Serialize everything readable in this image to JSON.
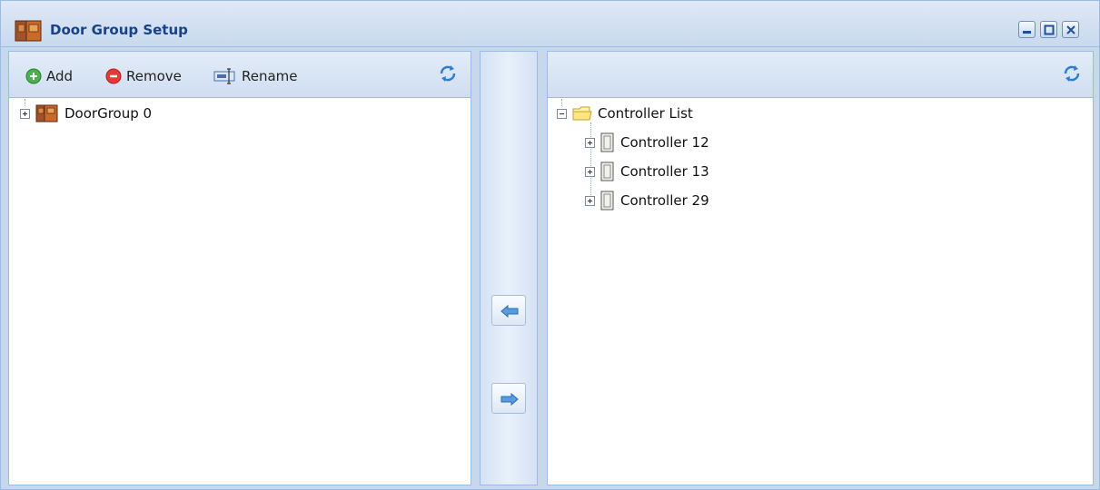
{
  "window": {
    "title": "Door Group Setup",
    "icon": "door-group-icon",
    "controls": [
      "minimize-icon",
      "maximize-icon",
      "close-icon"
    ]
  },
  "left_panel": {
    "toolbar": {
      "add_label": "Add",
      "remove_label": "Remove",
      "rename_label": "Rename",
      "refresh_icon": "refresh-icon"
    },
    "tree": [
      {
        "label": "DoorGroup 0",
        "icon": "door-group-icon",
        "expanded": false
      }
    ]
  },
  "transfer": {
    "move_left_icon": "arrow-left-icon",
    "move_right_icon": "arrow-right-icon"
  },
  "right_panel": {
    "toolbar": {
      "refresh_icon": "refresh-icon"
    },
    "tree": {
      "root": {
        "label": "Controller List",
        "icon": "folder-icon",
        "expanded": true
      },
      "children": [
        {
          "label": "Controller 12",
          "icon": "controller-icon",
          "expanded": false
        },
        {
          "label": "Controller 13",
          "icon": "controller-icon",
          "expanded": false
        },
        {
          "label": "Controller 29",
          "icon": "controller-icon",
          "expanded": false
        }
      ]
    }
  },
  "colors": {
    "title_text": "#15428b",
    "border": "#99bbe8",
    "background": "#c7d8ed"
  }
}
